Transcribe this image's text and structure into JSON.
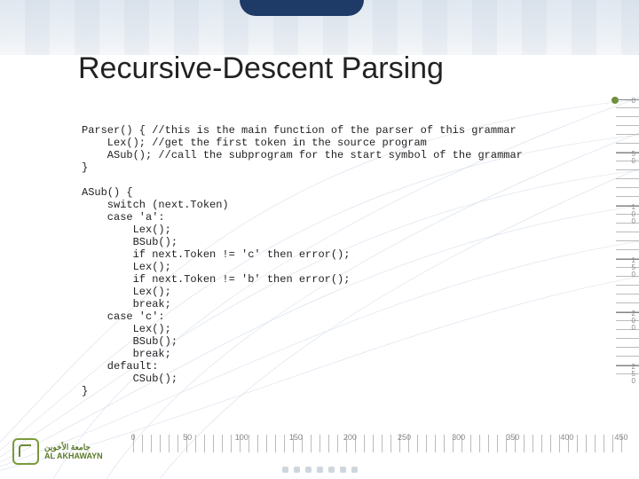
{
  "title": "Recursive-Descent Parsing",
  "code_lines": [
    "Parser() { //this is the main function of the parser of this grammar",
    "    Lex(); //get the first token in the source program",
    "    ASub(); //call the subprogram for the start symbol of the grammar",
    "}",
    "",
    "ASub() {",
    "    switch (next.Token)",
    "    case 'a':",
    "        Lex();",
    "        BSub();",
    "        if next.Token != 'c' then error();",
    "        Lex();",
    "        if next.Token != 'b' then error();",
    "        Lex();",
    "        break;",
    "    case 'c':",
    "        Lex();",
    "        BSub();",
    "        break;",
    "    default:",
    "        CSub();",
    "}"
  ],
  "ruler_v_labels": [
    "0",
    "50",
    "100",
    "150",
    "200",
    "250"
  ],
  "ruler_h_labels": [
    "0",
    "50",
    "100",
    "150",
    "200",
    "250",
    "300",
    "350",
    "400",
    "450"
  ],
  "logo": {
    "ar": "جامعة الأخوين",
    "en": "AL AKHAWAYN"
  }
}
